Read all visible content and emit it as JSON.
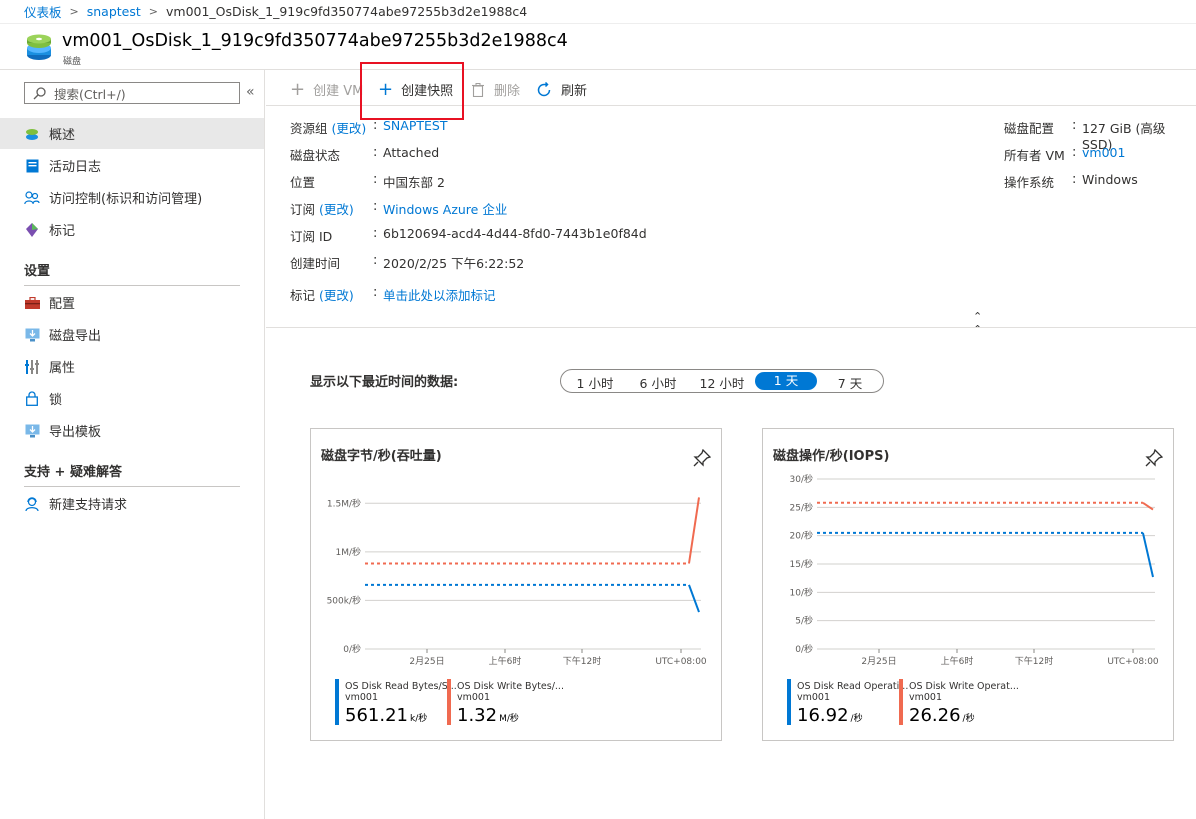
{
  "breadcrumb": [
    "仪表板",
    "snaptest",
    "vm001_OsDisk_1_919c9fd350774abe97255b3d2e1988c4"
  ],
  "header": {
    "title": "vm001_OsDisk_1_919c9fd350774abe97255b3d2e1988c4",
    "subtitle": "磁盘"
  },
  "sidebar": {
    "search_placeholder": "搜索(Ctrl+/)",
    "collapse": "«",
    "items": [
      {
        "label": "概述",
        "icon": "disk-icon"
      },
      {
        "label": "活动日志",
        "icon": "activity-log-icon"
      },
      {
        "label": "访问控制(标识和访问管理)",
        "icon": "people-icon"
      },
      {
        "label": "标记",
        "icon": "tag-icon"
      }
    ],
    "section_settings": "设置",
    "settings_items": [
      {
        "label": "配置",
        "icon": "toolbox-icon"
      },
      {
        "label": "磁盘导出",
        "icon": "export-icon"
      },
      {
        "label": "属性",
        "icon": "properties-icon"
      },
      {
        "label": "锁",
        "icon": "lock-icon"
      },
      {
        "label": "导出模板",
        "icon": "template-icon"
      }
    ],
    "section_support": "支持 + 疑难解答",
    "support_items": [
      {
        "label": "新建支持请求",
        "icon": "support-person-icon"
      }
    ]
  },
  "toolbar": {
    "create_vm": "创建 VM",
    "create_snapshot": "创建快照",
    "delete": "删除",
    "refresh": "刷新"
  },
  "essentials": {
    "left": [
      {
        "label": "资源组",
        "change": "(更改)",
        "value": "SNAPTEST",
        "link": true
      },
      {
        "label": "磁盘状态",
        "value": "Attached",
        "link": false
      },
      {
        "label": "位置",
        "value": "中国东部 2",
        "link": false
      },
      {
        "label": "订阅",
        "change": "(更改)",
        "value": "Windows Azure 企业",
        "link": true
      },
      {
        "label": "订阅 ID",
        "value": "6b120694-acd4-4d44-8fd0-7443b1e0f84d",
        "link": false
      },
      {
        "label": "创建时间",
        "value": "2020/2/25 下午6:22:52",
        "link": false
      },
      {
        "label": "标记",
        "change": "(更改)",
        "value": "单击此处以添加标记",
        "link": true
      }
    ],
    "right": [
      {
        "label": "磁盘配置",
        "value": "127 GiB (高级 SSD)",
        "link": false
      },
      {
        "label": "所有者 VM",
        "value": "vm001",
        "link": true
      },
      {
        "label": "操作系统",
        "value": "Windows",
        "link": false
      }
    ]
  },
  "time_range": {
    "label": "显示以下最近时间的数据:",
    "options": [
      "1 小时",
      "6 小时",
      "12 小时",
      "1 天",
      "7 天"
    ],
    "selected": "1 天"
  },
  "chart_data": [
    {
      "type": "line",
      "title": "磁盘字节/秒(吞吐量)",
      "y_ticks": [
        "0/秒",
        "500k/秒",
        "1M/秒",
        "1.5M/秒"
      ],
      "y_tick_values": [
        0,
        500000,
        1000000,
        1500000
      ],
      "x_ticks": [
        "2月25日",
        "上午6时",
        "下午12时",
        "UTC+08:00"
      ],
      "ylim": [
        0,
        1750000
      ],
      "series": [
        {
          "name": "OS Disk Read Bytes/S...",
          "resource": "vm001",
          "color": "#0078d4",
          "value": "561.21",
          "unit": "k/秒",
          "points": [
            [
              0,
              660000
            ],
            [
              0.96,
              660000
            ],
            [
              0.97,
              660000
            ],
            [
              1.0,
              380000
            ]
          ]
        },
        {
          "name": "OS Disk Write Bytes/...",
          "resource": "vm001",
          "color": "#f06a50",
          "value": "1.32",
          "unit": "M/秒",
          "points": [
            [
              0,
              880000
            ],
            [
              0.96,
              880000
            ],
            [
              0.97,
              880000
            ],
            [
              1.0,
              1560000
            ]
          ]
        }
      ]
    },
    {
      "type": "line",
      "title": "磁盘操作/秒(IOPS)",
      "y_ticks": [
        "0/秒",
        "5/秒",
        "10/秒",
        "15/秒",
        "20/秒",
        "25/秒",
        "30/秒"
      ],
      "y_tick_values": [
        0,
        5,
        10,
        15,
        20,
        25,
        30
      ],
      "x_ticks": [
        "2月25日",
        "上午6时",
        "下午12时",
        "UTC+08:00"
      ],
      "ylim": [
        0,
        30
      ],
      "series": [
        {
          "name": "OS Disk Read Operati...",
          "resource": "vm001",
          "color": "#0078d4",
          "value": "16.92",
          "unit": "/秒",
          "points": [
            [
              0,
              20.5
            ],
            [
              0.96,
              20.5
            ],
            [
              0.97,
              20.5
            ],
            [
              1.0,
              12.7
            ]
          ]
        },
        {
          "name": "OS Disk Write Operat...",
          "resource": "vm001",
          "color": "#f06a50",
          "value": "26.26",
          "unit": "/秒",
          "points": [
            [
              0,
              25.8
            ],
            [
              0.96,
              25.8
            ],
            [
              0.97,
              25.8
            ],
            [
              1.0,
              24.6
            ]
          ]
        }
      ]
    }
  ]
}
